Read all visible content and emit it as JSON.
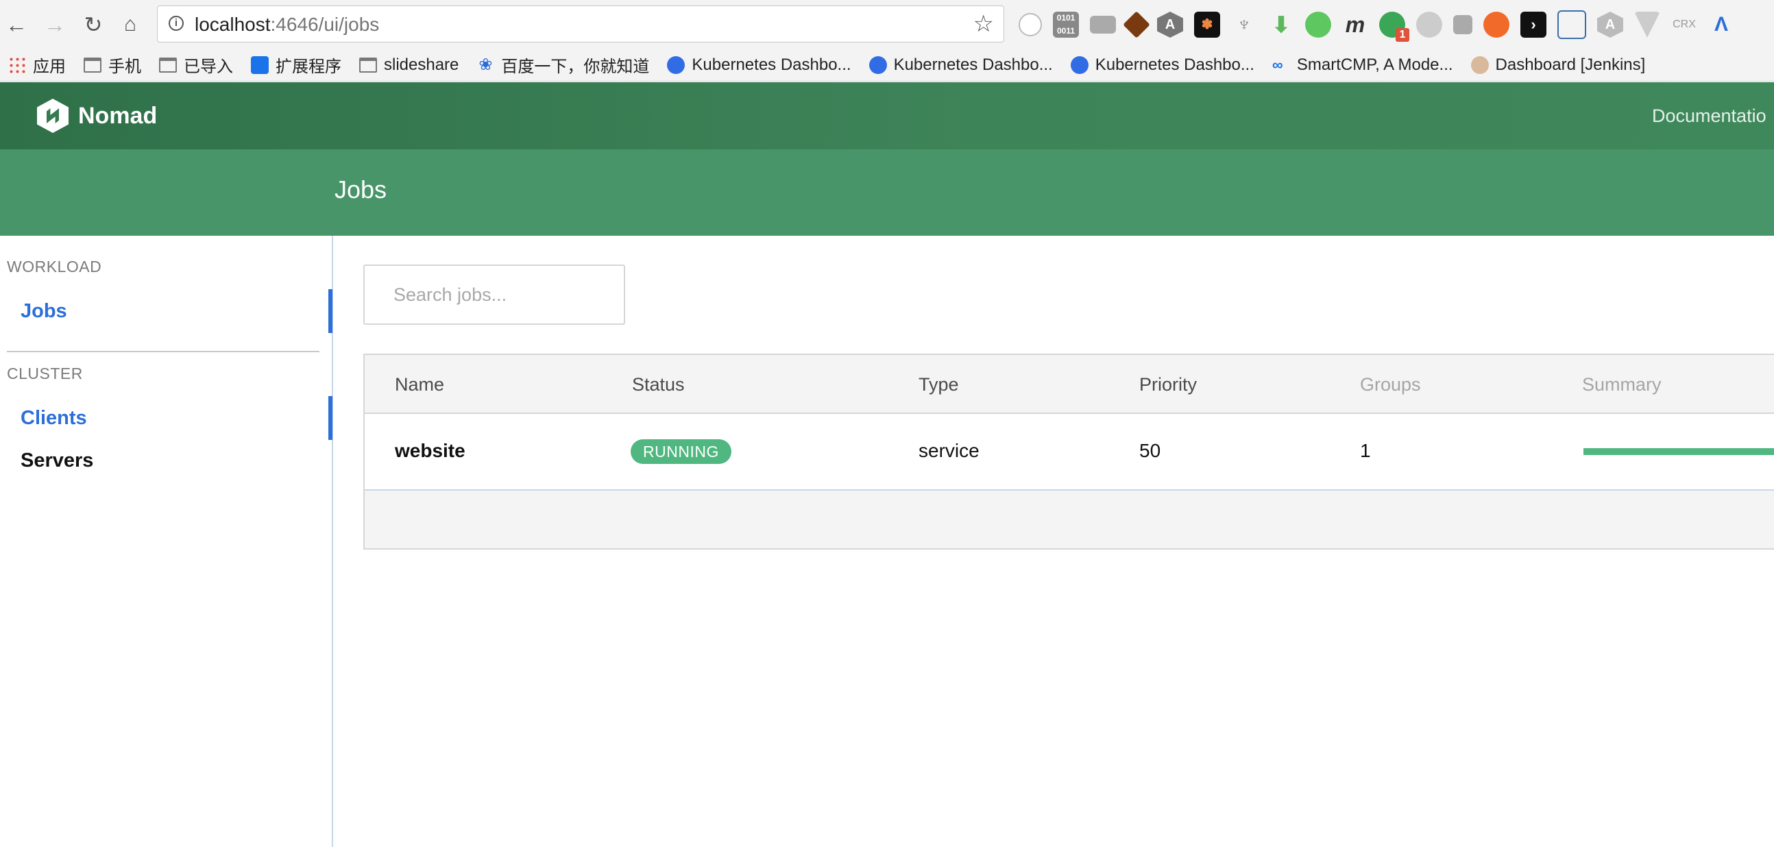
{
  "browser": {
    "url_host": "localhost",
    "url_rest": ":4646/ui/jobs",
    "bookmarks": [
      {
        "label": "应用",
        "icon": "apps-grid-icon"
      },
      {
        "label": "手机",
        "icon": "folder-icon"
      },
      {
        "label": "已导入",
        "icon": "folder-icon"
      },
      {
        "label": "扩展程序",
        "icon": "puzzle-icon"
      },
      {
        "label": "slideshare",
        "icon": "folder-icon"
      },
      {
        "label": "百度一下，你就知道",
        "icon": "baidu-paw-icon"
      },
      {
        "label": "Kubernetes Dashbo...",
        "icon": "kubernetes-icon"
      },
      {
        "label": "Kubernetes Dashbo...",
        "icon": "kubernetes-icon"
      },
      {
        "label": "Kubernetes Dashbo...",
        "icon": "kubernetes-icon"
      },
      {
        "label": "SmartCMP, A Mode...",
        "icon": "smartcmp-icon"
      },
      {
        "label": "Dashboard [Jenkins]",
        "icon": "jenkins-icon"
      }
    ],
    "extension_badge": "1"
  },
  "header": {
    "brand": "Nomad",
    "doc_link": "Documentatio"
  },
  "page": {
    "title": "Jobs"
  },
  "sidebar": {
    "workload_label": "WORKLOAD",
    "workload_items": [
      {
        "label": "Jobs"
      }
    ],
    "cluster_label": "CLUSTER",
    "cluster_items": [
      {
        "label": "Clients"
      },
      {
        "label": "Servers"
      }
    ]
  },
  "search": {
    "placeholder": "Search jobs..."
  },
  "jobs_table": {
    "columns": [
      "Name",
      "Status",
      "Type",
      "Priority",
      "Groups",
      "Summary"
    ],
    "rows": [
      {
        "name": "website",
        "status": "RUNNING",
        "type": "service",
        "priority": "50",
        "groups": "1"
      }
    ]
  },
  "colors": {
    "nomad_green": "#3f885b",
    "subheader_green": "#48956a",
    "running_badge": "#4fb77f",
    "active_link": "#2c6fd9"
  }
}
